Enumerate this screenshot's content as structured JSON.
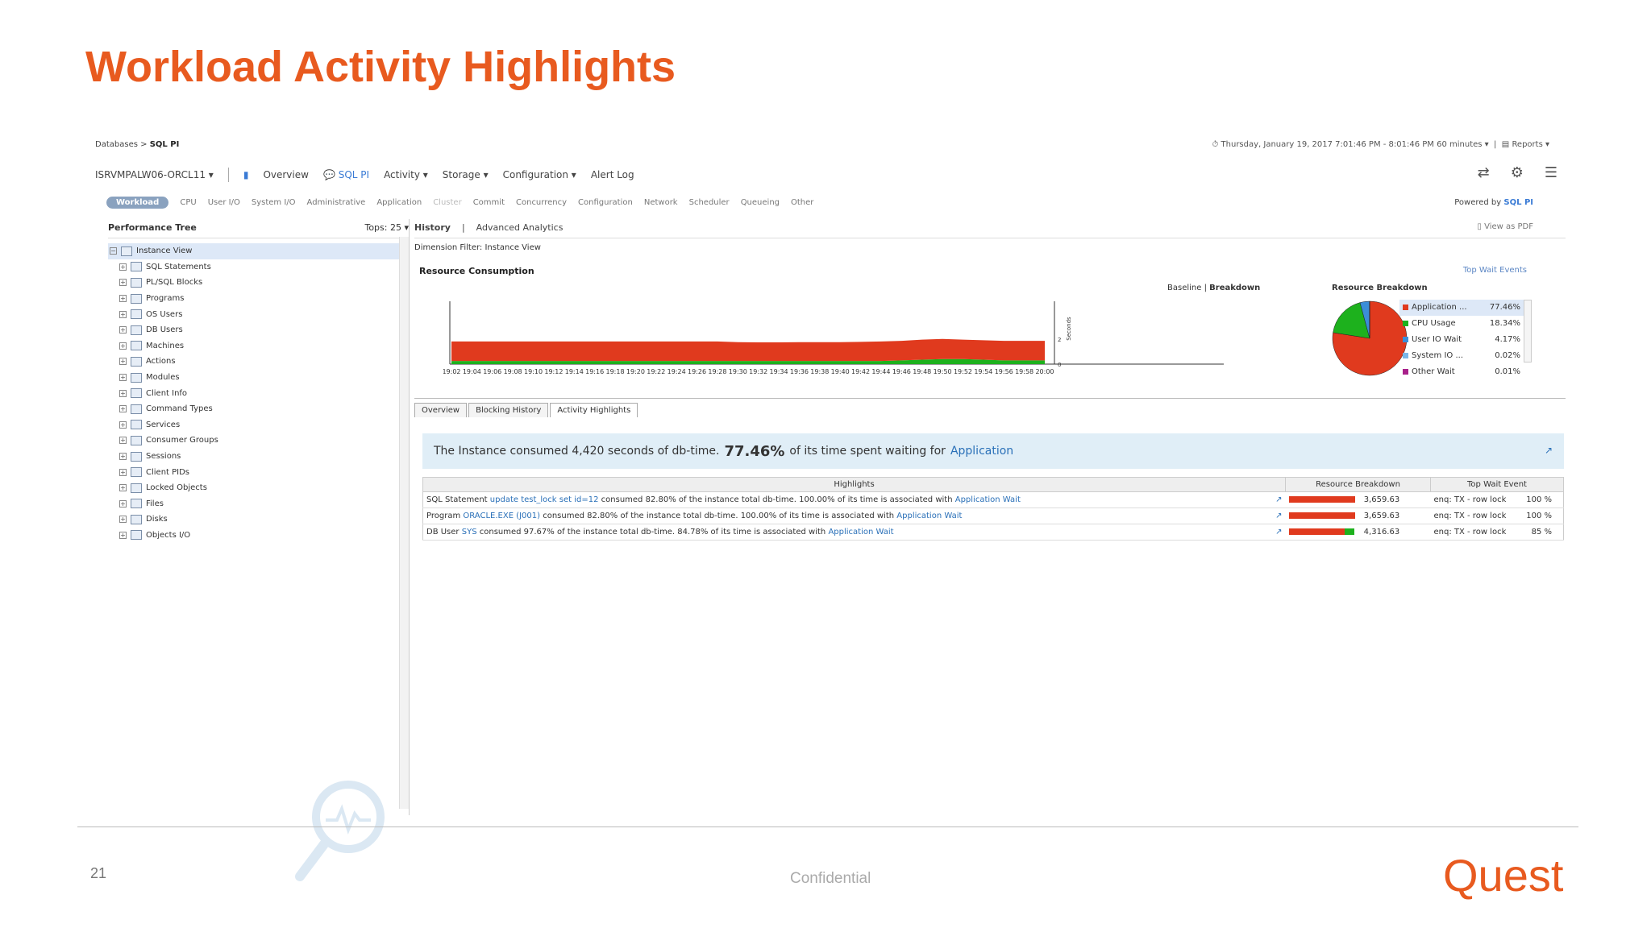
{
  "slide": {
    "title": "Workload Activity Highlights",
    "page_number": "21",
    "footer": "Confidential",
    "logo": "Quest"
  },
  "breadcrumb": {
    "root": "Databases",
    "sep": ">",
    "current": "SQL PI"
  },
  "time_range": {
    "label": "Thursday, January 19, 2017 7:01:46 PM - 8:01:46 PM 60 minutes",
    "reports": "Reports"
  },
  "nav": {
    "instance": "ISRVMPALW06-ORCL11",
    "overview": "Overview",
    "sqlpi": "SQL PI",
    "activity": "Activity",
    "storage": "Storage",
    "configuration": "Configuration",
    "alert_log": "Alert Log"
  },
  "workload_tabs": [
    "Workload",
    "CPU",
    "User I/O",
    "System I/O",
    "Administrative",
    "Application",
    "Cluster",
    "Commit",
    "Concurrency",
    "Configuration",
    "Network",
    "Scheduler",
    "Queueing",
    "Other"
  ],
  "powered_by": {
    "text": "Powered by",
    "brand": "SQL PI"
  },
  "perf_tree": {
    "title": "Performance Tree",
    "tops": "Tops: 25",
    "items": [
      "Instance View",
      "SQL Statements",
      "PL/SQL Blocks",
      "Programs",
      "OS Users",
      "DB Users",
      "Machines",
      "Actions",
      "Modules",
      "Client Info",
      "Command Types",
      "Services",
      "Consumer Groups",
      "Sessions",
      "Client PIDs",
      "Locked Objects",
      "Files",
      "Disks",
      "Objects I/O"
    ]
  },
  "view_tabs": {
    "history": "History",
    "sep": "|",
    "advanced": "Advanced Analytics",
    "pdf": "View as PDF"
  },
  "dimension_filter": "Dimension Filter: Instance View",
  "resource_consumption": {
    "title": "Resource Consumption",
    "top_wait_events": "Top Wait Events",
    "baseline": "Baseline",
    "sep": "|",
    "breakdown": "Breakdown"
  },
  "chart_data": [
    {
      "type": "area",
      "title": "Resource Consumption",
      "ylabel": "Seconds",
      "x": [
        "19:02",
        "19:04",
        "19:06",
        "19:08",
        "19:10",
        "19:12",
        "19:14",
        "19:16",
        "19:18",
        "19:20",
        "19:22",
        "19:24",
        "19:26",
        "19:28",
        "19:30",
        "19:32",
        "19:34",
        "19:36",
        "19:38",
        "19:40",
        "19:42",
        "19:44",
        "19:46",
        "19:48",
        "19:50",
        "19:52",
        "19:54",
        "19:56",
        "19:58",
        "20:00"
      ],
      "yticks": [
        "0",
        "2"
      ],
      "ylim": [
        0,
        5
      ],
      "series": [
        {
          "name": "CPU Usage",
          "color": "#1db11d",
          "values": [
            0.25,
            0.25,
            0.25,
            0.25,
            0.25,
            0.25,
            0.25,
            0.25,
            0.25,
            0.25,
            0.25,
            0.25,
            0.25,
            0.25,
            0.25,
            0.25,
            0.25,
            0.25,
            0.25,
            0.25,
            0.25,
            0.25,
            0.3,
            0.35,
            0.4,
            0.4,
            0.35,
            0.3,
            0.3,
            0.3
          ]
        },
        {
          "name": "Application",
          "color": "#e03a1e",
          "values": [
            1.55,
            1.55,
            1.55,
            1.55,
            1.55,
            1.55,
            1.55,
            1.55,
            1.55,
            1.55,
            1.55,
            1.55,
            1.55,
            1.55,
            1.5,
            1.48,
            1.48,
            1.5,
            1.5,
            1.5,
            1.52,
            1.55,
            1.55,
            1.6,
            1.6,
            1.55,
            1.55,
            1.55,
            1.55,
            1.55
          ]
        }
      ]
    },
    {
      "type": "pie",
      "title": "Resource Breakdown",
      "categories": [
        "Application",
        "CPU Usage",
        "User IO Wait",
        "System IO",
        "Other Wait"
      ],
      "values": [
        77.46,
        18.34,
        4.17,
        0.02,
        0.01
      ],
      "colors": [
        "#e03a1e",
        "#1db11d",
        "#3b8ed8",
        "#7ab6e8",
        "#a8208a"
      ]
    }
  ],
  "legend": [
    {
      "name": "Application ...",
      "pct": "77.46%",
      "color": "#e03a1e"
    },
    {
      "name": "CPU Usage",
      "pct": "18.34%",
      "color": "#1db11d"
    },
    {
      "name": "User IO Wait",
      "pct": "4.17%",
      "color": "#3b8ed8"
    },
    {
      "name": "System IO ...",
      "pct": "0.02%",
      "color": "#7ab6e8"
    },
    {
      "name": "Other Wait",
      "pct": "0.01%",
      "color": "#a8208a"
    }
  ],
  "detail_tabs": [
    "Overview",
    "Blocking History",
    "Activity Highlights"
  ],
  "banner": {
    "pre": "The Instance consumed 4,420 seconds of db-time.",
    "pct": "77.46%",
    "mid": "of its time spent waiting for",
    "target": "Application"
  },
  "highlights_table": {
    "headers": [
      "Highlights",
      "Resource Breakdown",
      "Top Wait Event"
    ],
    "rows": [
      {
        "type": "SQL Statement",
        "link": "update test_lock set id=12",
        "text": "consumed 82.80% of the instance total db-time. 100.00% of its time is associated with",
        "wait_link": "Application Wait",
        "red": 1.0,
        "green": 0.0,
        "value": "3,659.63",
        "event": "enq: TX - row lock",
        "event_pct": "100 %"
      },
      {
        "type": "Program",
        "link": "ORACLE.EXE (J001)",
        "text": "consumed 82.80% of the instance total db-time. 100.00% of its time is associated with",
        "wait_link": "Application Wait",
        "red": 1.0,
        "green": 0.0,
        "value": "3,659.63",
        "event": "enq: TX - row lock",
        "event_pct": "100 %"
      },
      {
        "type": "DB User",
        "link": "SYS",
        "text": "consumed 97.67% of the instance total db-time. 84.78% of its time is associated with",
        "wait_link": "Application Wait",
        "red": 0.85,
        "green": 0.15,
        "value": "4,316.63",
        "event": "enq: TX - row lock",
        "event_pct": "85 %"
      }
    ]
  }
}
